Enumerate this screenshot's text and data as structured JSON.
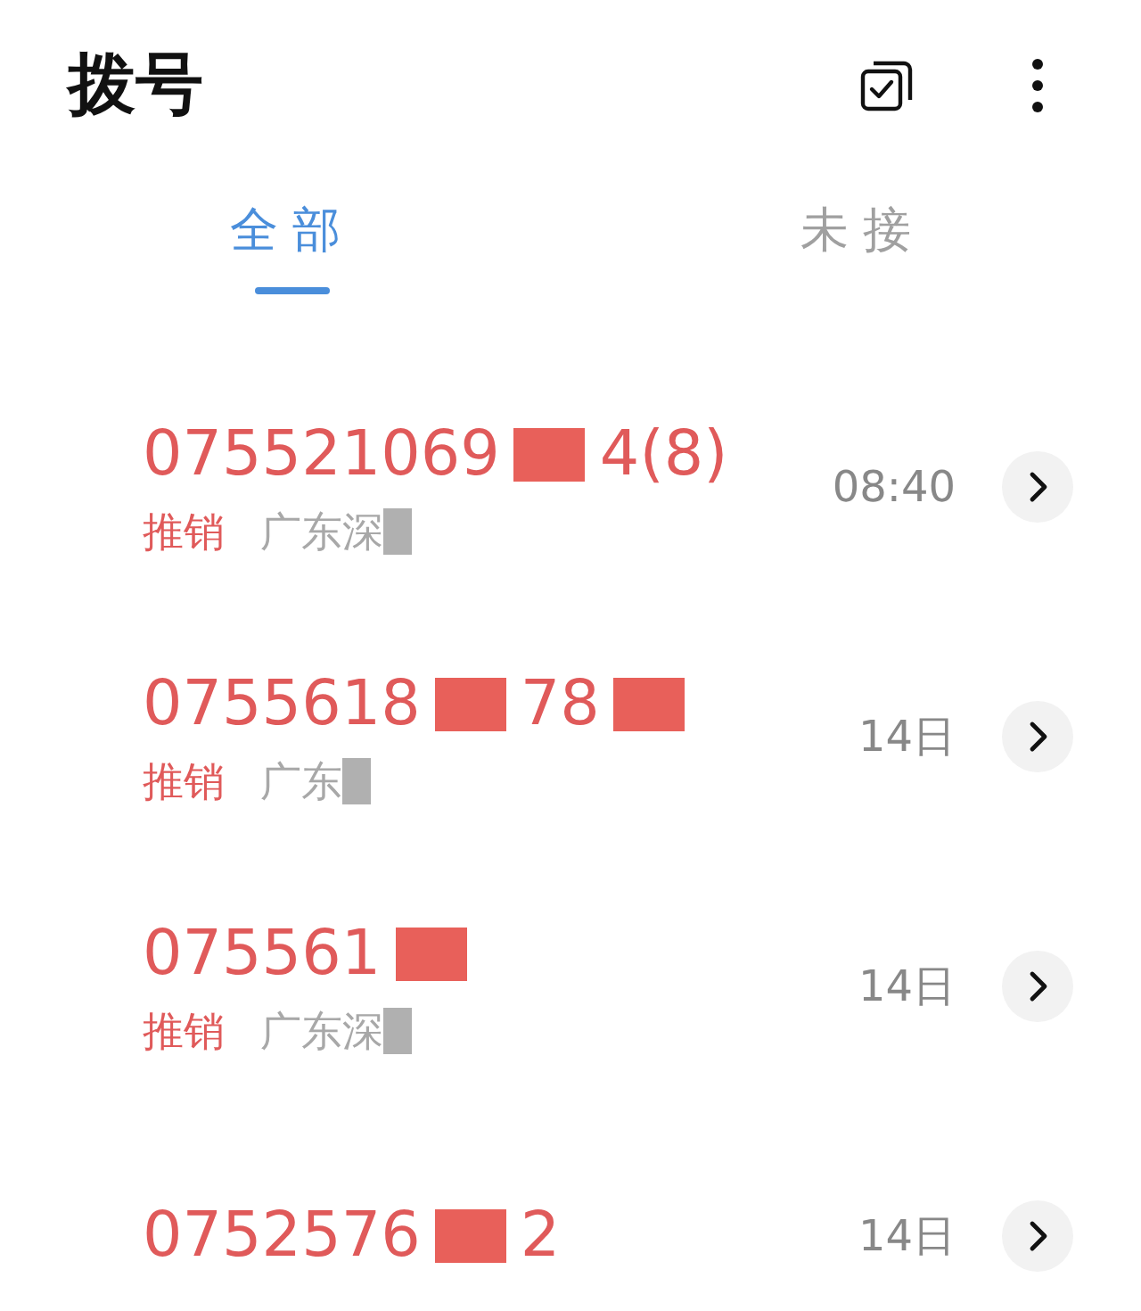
{
  "header": {
    "title": "拨号"
  },
  "tabs": [
    {
      "label": "全部",
      "selected": true
    },
    {
      "label": "未接",
      "selected": false
    }
  ],
  "calls": [
    {
      "number": [
        {
          "kind": "text",
          "text": "075521069"
        },
        {
          "kind": "redaction"
        },
        {
          "kind": "text",
          "text": "4(8)"
        }
      ],
      "tag": "推销",
      "location": [
        {
          "kind": "text",
          "text": "广东深"
        },
        {
          "kind": "redaction"
        }
      ],
      "time": "08:40"
    },
    {
      "number": [
        {
          "kind": "text",
          "text": "0755618"
        },
        {
          "kind": "redaction"
        },
        {
          "kind": "text",
          "text": "78"
        },
        {
          "kind": "redaction"
        }
      ],
      "tag": "推销",
      "location": [
        {
          "kind": "text",
          "text": "广东"
        },
        {
          "kind": "redaction"
        }
      ],
      "time": "14日"
    },
    {
      "number": [
        {
          "kind": "text",
          "text": "075561"
        },
        {
          "kind": "redaction"
        }
      ],
      "tag": "推销",
      "location": [
        {
          "kind": "text",
          "text": "广东深"
        },
        {
          "kind": "redaction"
        }
      ],
      "time": "14日"
    },
    {
      "number": [
        {
          "kind": "text",
          "text": "0752576"
        },
        {
          "kind": "redaction"
        },
        {
          "kind": "text",
          "text": "2"
        }
      ],
      "time": "14日"
    }
  ]
}
